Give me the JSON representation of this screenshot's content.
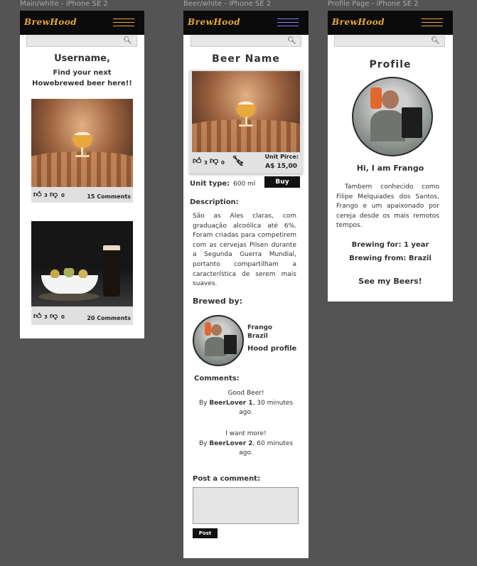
{
  "frames": {
    "main_title": "Main/white - iPhone SE 2",
    "beer_title": "Beer/white - iPhone SE 2",
    "profile_title": "Profile Page - iPhone SE 2"
  },
  "brand": {
    "logo": "BrewHood",
    "color": "#e8a73a"
  },
  "search": {
    "icon": "search-icon"
  },
  "main": {
    "greeting": "Username,",
    "tagline_line1": "Find your next",
    "tagline_line2": "Howebrewed beer here!!",
    "cards": [
      {
        "likes": "3",
        "dislikes": "0",
        "comments": "15  Comments"
      },
      {
        "likes": "3",
        "dislikes": "0",
        "comments": "20  Comments"
      }
    ]
  },
  "beer": {
    "title": "Beer Name",
    "likes": "3",
    "dislikes": "0",
    "bottles": "2",
    "price_label": "Unit Pirce:",
    "price": "A$ 15,00",
    "unit_type_label": "Unit type:",
    "unit_type_value": "600 ml",
    "buy_label": "Buy",
    "description_label": "Description:",
    "description": "São as Ales claras, com graduação alcoólica até 6%. Foram criadas para competirem com as cervejas Pilsen durante a Segunda Guerra Mundial, portanto compartilham a característica de serem mais suaves.",
    "brewed_by_label": "Brewed by:",
    "brewer_name": "Frango",
    "brewer_country": "Brazil",
    "hood_profile_label": "Hood profile",
    "comments_label": "Comments:",
    "comments": [
      {
        "text": "Good Beer!",
        "by": "By ",
        "user": "BeerLover 1",
        "when": ", 30 minutes ago."
      },
      {
        "text": "I want more!",
        "by": "By ",
        "user": "BeerLover 2",
        "when": ", 60 minutes ago."
      }
    ],
    "post_label": "Post a comment:",
    "post_button": "Post"
  },
  "profile": {
    "title": "Profile",
    "hi": "Hi, I am Frango",
    "bio": "Tambem conhecido como Filipe Melquiades dos Santos, Frango e um apaixonado por cereja desde os mais remotos tempos.",
    "brewing_for": "Brewing for: 1 year",
    "brewing_from": "Brewing from: Brazil",
    "see_beers": "See my Beers!"
  }
}
